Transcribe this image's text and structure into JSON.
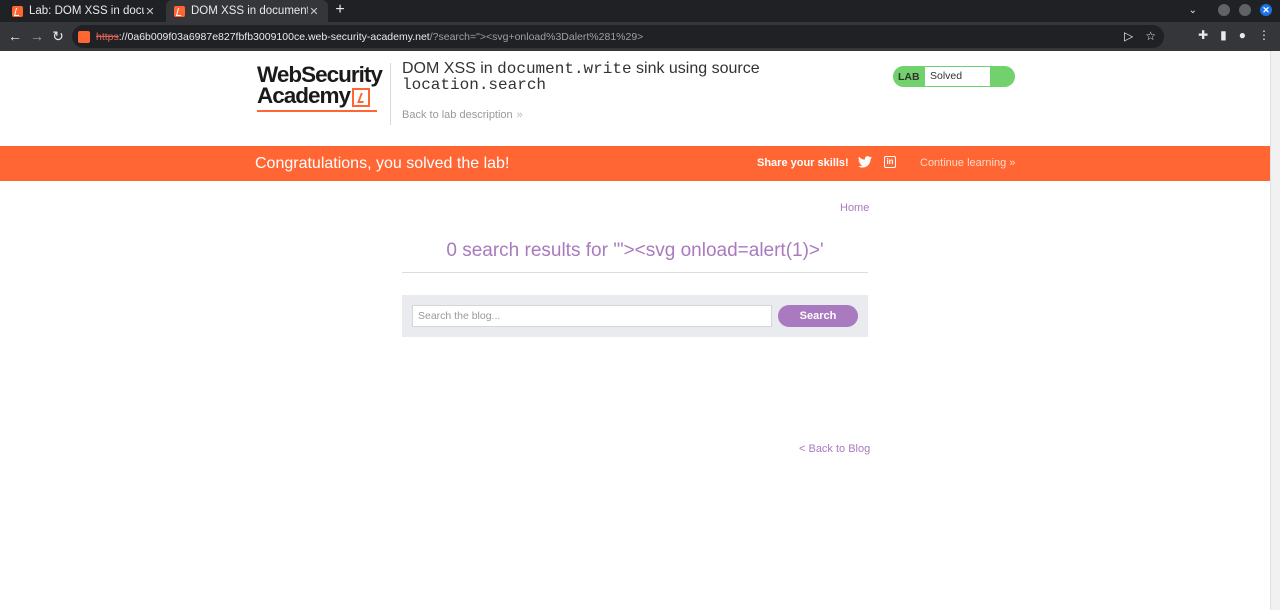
{
  "browser": {
    "tabs": [
      {
        "title": "Lab: DOM XSS in docume",
        "active": false
      },
      {
        "title": "DOM XSS in document.w",
        "active": true
      }
    ],
    "url": {
      "scheme": "https",
      "host": "://0a6b009f03a6987e827fbfb3009100ce.web-security-academy.net",
      "path": "/?search=\"><svg+onload%3Dalert%281%29>"
    },
    "icons": [
      "back-arrow-icon",
      "forward-arrow-icon",
      "reload-icon",
      "send-icon",
      "star-icon",
      "extensions-icon",
      "side-panel-icon",
      "profile-icon",
      "menu-icon"
    ]
  },
  "header": {
    "logo_line1": "WebSecurity",
    "logo_line2": "Academy",
    "title_part1": "DOM XSS in ",
    "title_code1": "document.write",
    "title_part2": " sink using source",
    "title_code2": "location.search",
    "back_link": "Back to lab description",
    "lab_label": "LAB",
    "lab_status": "Solved"
  },
  "banner": {
    "message": "Congratulations, you solved the lab!",
    "share": "Share your skills!",
    "continue": "Continue learning"
  },
  "main": {
    "home_link": "Home",
    "results_heading": "0 search results for '\"><svg onload=alert(1)>'",
    "search_placeholder": "Search the blog...",
    "search_button": "Search",
    "back_to_blog": "< Back to Blog"
  },
  "colors": {
    "accent_orange": "#ff6633",
    "link_purple": "#a97abf",
    "lab_green": "#70d16d"
  }
}
